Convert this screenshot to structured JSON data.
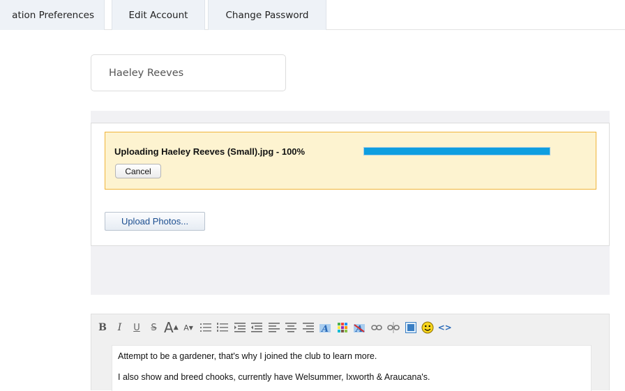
{
  "tabs": [
    {
      "label": "ation Preferences"
    },
    {
      "label": "Edit Account"
    },
    {
      "label": "Change Password"
    }
  ],
  "profile": {
    "name": "Haeley Reeves"
  },
  "upload": {
    "status_text": "Uploading Haeley Reeves (Small).jpg - 100%",
    "progress": 1.0,
    "cancel_label": "Cancel",
    "upload_button_label": "Upload Photos..."
  },
  "editor": {
    "toolbar": [
      "bold-icon",
      "italic-icon",
      "underline-icon",
      "strikethrough-icon",
      "font-size-increase-icon",
      "font-size-decrease-icon",
      "bulleted-list-icon",
      "numbered-list-icon",
      "outdent-icon",
      "indent-icon",
      "align-left-icon",
      "align-center-icon",
      "align-right-icon",
      "text-color-icon",
      "background-color-icon",
      "remove-format-icon",
      "insert-link-icon",
      "remove-link-icon",
      "insert-image-icon",
      "emoticon-icon",
      "source-code-icon"
    ],
    "paragraphs": [
      "Attempt to be a gardener, that's why I joined the club to learn more.",
      "I also show and breed chooks, currently have Welsummer, Ixworth & Araucana's."
    ]
  },
  "colors": {
    "tab_bg": "#eef2f7",
    "progress_fill": "#0e9ee0",
    "progress_box_bg": "#fdf3d0",
    "progress_box_border": "#f0b43a",
    "upload_link_text": "#1a4d8f"
  }
}
